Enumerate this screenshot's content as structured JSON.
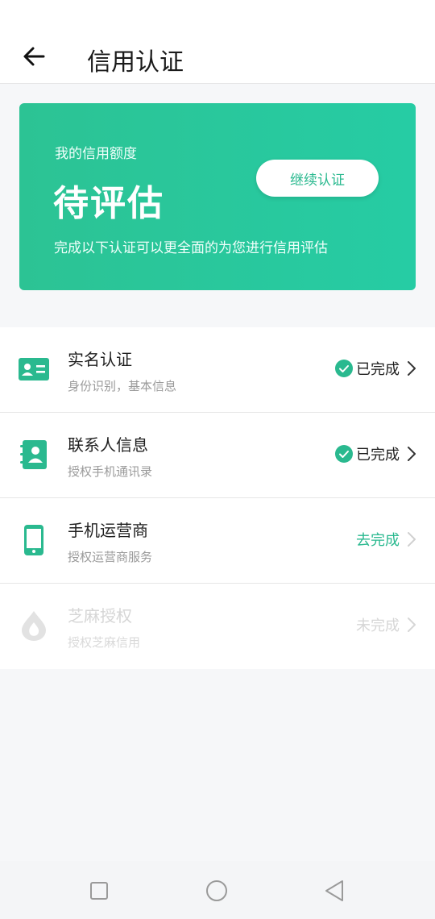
{
  "header": {
    "title": "信用认证",
    "back_icon": "back-arrow-icon"
  },
  "card": {
    "label": "我的信用额度",
    "status": "待评估",
    "description": "完成以下认证可以更全面的为您进行信用评估",
    "button_label": "继续认证",
    "gradient_start": "#2cc394",
    "gradient_end": "#26cca4"
  },
  "items": [
    {
      "title": "实名认证",
      "subtitle": "身份识别，基本信息",
      "status": "已完成",
      "icon": "id-card-icon",
      "state": "done"
    },
    {
      "title": "联系人信息",
      "subtitle": "授权手机通讯录",
      "status": "已完成",
      "icon": "contacts-book-icon",
      "state": "done"
    },
    {
      "title": "手机运营商",
      "subtitle": "授权运营商服务",
      "status": "去完成",
      "icon": "mobile-phone-icon",
      "state": "todo"
    },
    {
      "title": "芝麻授权",
      "subtitle": "授权芝麻信用",
      "status": "未完成",
      "icon": "sesame-drop-icon",
      "state": "disabled"
    }
  ],
  "colors": {
    "accent": "#2ab98f",
    "text": "#1f1f1f",
    "muted": "#9a9a9a",
    "disabled": "#d6d6d6"
  },
  "navbar": {
    "icons": [
      "recent-apps-icon",
      "home-icon",
      "back-icon"
    ]
  }
}
